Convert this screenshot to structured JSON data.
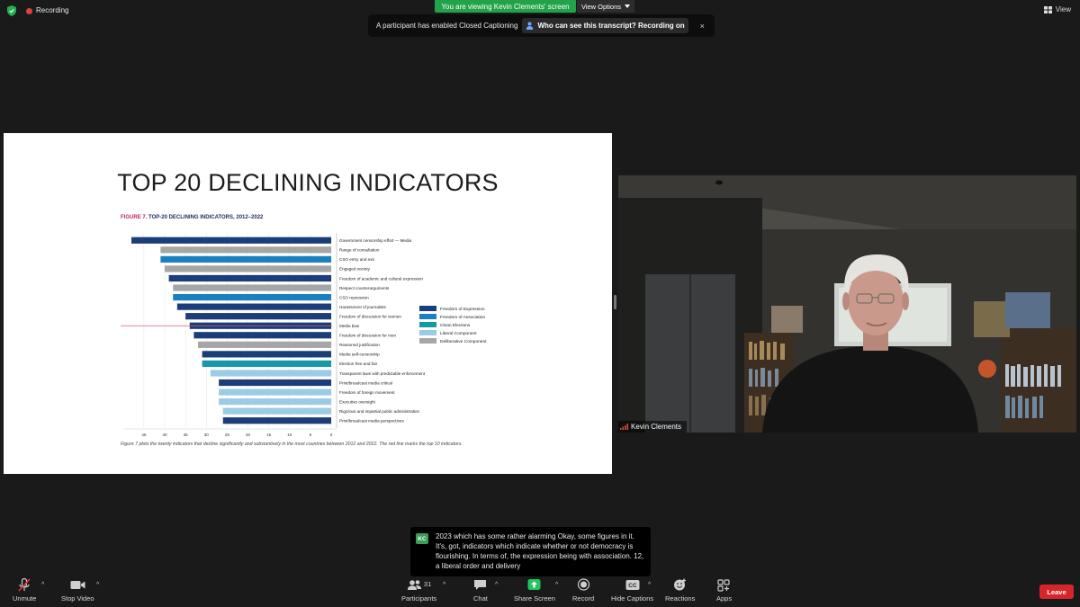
{
  "topbar": {
    "recording_label": "Recording",
    "viewing_banner": "You are viewing Kevin Clements' screen",
    "view_options_label": "View Options",
    "view_label": "View"
  },
  "cc_notice": {
    "message": "A participant has enabled Closed Captioning",
    "who_label": "Who can see this transcript? Recording on",
    "close_glyph": "×"
  },
  "slide": {
    "title": "TOP 20 DECLINING INDICATORS",
    "figure_label_prefix": "FIGURE 7.",
    "figure_label_rest": " TOP-20 DECLINING INDICATORS, 2012–2022",
    "caption": "Figure 7 plots the twenty indicators that decline significantly and substantively in the most countries between 2012 and 2022. The red line marks the top 10 indicators."
  },
  "chart_data": {
    "type": "bar",
    "orientation": "horizontal",
    "x_axis": "reversed",
    "xlim": [
      0,
      48
    ],
    "xticks": [
      "45",
      "40",
      "35",
      "30",
      "25",
      "20",
      "15",
      "10",
      "5",
      "0"
    ],
    "categories": [
      "Government censorship effort — Media",
      "Range of consultation",
      "CSO entry and exit",
      "Engaged society",
      "Freedom of academic and cultural expression",
      "Respect counterarguments",
      "CSO repression",
      "Harassment of journalists",
      "Freedom of discussion for women",
      "Media bias",
      "Freedom of discussion for men",
      "Reasoned justification",
      "Media self-censorship",
      "Election free and fair",
      "Transparent laws with predictable enforcement",
      "Print/broadcast media critical",
      "Freedom of foreign movement",
      "Executive oversight",
      "Rigorous and impartial public administration",
      "Print/broadcast media perspectives"
    ],
    "values": [
      48,
      41,
      41,
      40,
      39,
      38,
      38,
      37,
      35,
      34,
      33,
      32,
      31,
      31,
      29,
      27,
      27,
      27,
      26,
      26
    ],
    "groups": [
      0,
      4,
      1,
      4,
      0,
      4,
      1,
      0,
      0,
      0,
      0,
      4,
      0,
      2,
      3,
      0,
      3,
      3,
      3,
      0
    ],
    "legend": [
      {
        "name": "Freedom of Expression",
        "color": "#1b3d7a"
      },
      {
        "name": "Freedom of Association",
        "color": "#1b80bf"
      },
      {
        "name": "Clean Elections",
        "color": "#1798a8"
      },
      {
        "name": "Liberal Component",
        "color": "#9ccbe6"
      },
      {
        "name": "Deliberative Component",
        "color": "#a6a6a6"
      }
    ],
    "legend_position": "right",
    "marker_line_color": "#e05a7a",
    "grid": true
  },
  "video": {
    "speaker_name": "Kevin Clements"
  },
  "captions": {
    "avatar_initials": "KC",
    "text": "2023 which has some rather alarming Okay, some figures in it. It's, got, indicators which indicate whether or not democracy is flourishing. In terms of, the expression being with association. 12, a liberal order and delivery"
  },
  "toolbar": {
    "unmute": "Unmute",
    "stop_video": "Stop Video",
    "participants": "Participants",
    "participants_count": "31",
    "chat": "Chat",
    "share_screen": "Share Screen",
    "record": "Record",
    "hide_captions": "Hide Captions",
    "reactions": "Reactions",
    "apps": "Apps",
    "leave": "Leave",
    "cc_icon_text": "CC",
    "caret_glyph": "^",
    "share_color": "#23c45e",
    "leave_color": "#d6262c"
  }
}
